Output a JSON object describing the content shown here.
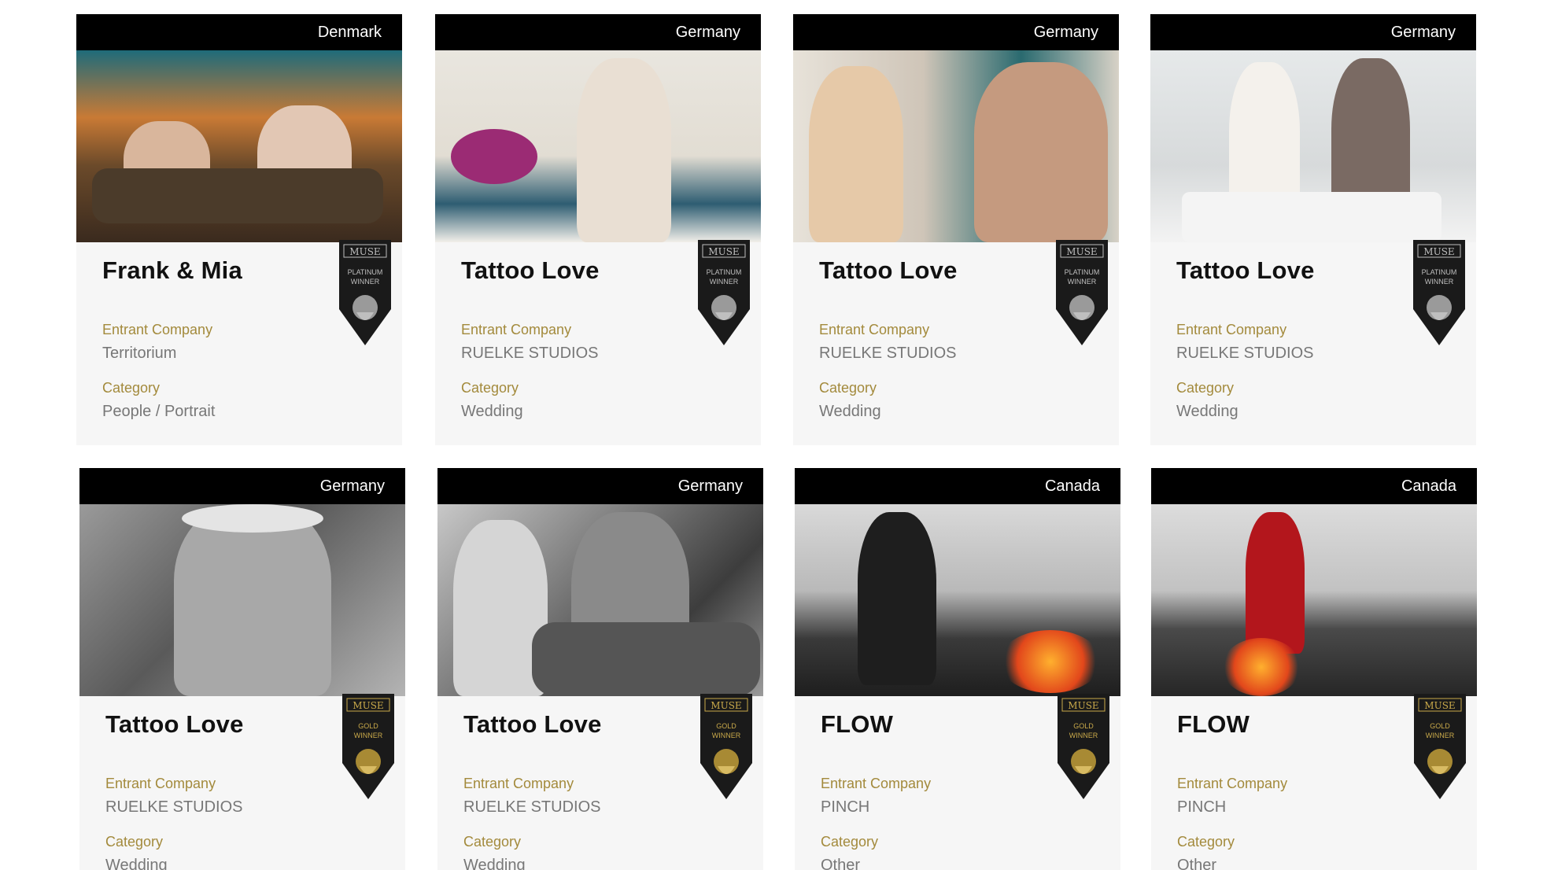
{
  "cards": [
    {
      "country": "Denmark",
      "title": "Frank & Mia",
      "entrant_label": "Entrant Company",
      "entrant": "Territorium",
      "category_label": "Category",
      "category": "People / Portrait",
      "award": "platinum",
      "badge": {
        "brand": "MUSE",
        "line1": "PLATINUM",
        "line2": "WINNER"
      }
    },
    {
      "country": "Germany",
      "title": "Tattoo Love",
      "entrant_label": "Entrant Company",
      "entrant": "RUELKE STUDIOS",
      "category_label": "Category",
      "category": "Wedding",
      "award": "platinum",
      "badge": {
        "brand": "MUSE",
        "line1": "PLATINUM",
        "line2": "WINNER"
      }
    },
    {
      "country": "Germany",
      "title": "Tattoo Love",
      "entrant_label": "Entrant Company",
      "entrant": "RUELKE STUDIOS",
      "category_label": "Category",
      "category": "Wedding",
      "award": "platinum",
      "badge": {
        "brand": "MUSE",
        "line1": "PLATINUM",
        "line2": "WINNER"
      }
    },
    {
      "country": "Germany",
      "title": "Tattoo Love",
      "entrant_label": "Entrant Company",
      "entrant": "RUELKE STUDIOS",
      "category_label": "Category",
      "category": "Wedding",
      "award": "platinum",
      "badge": {
        "brand": "MUSE",
        "line1": "PLATINUM",
        "line2": "WINNER"
      }
    },
    {
      "country": "Germany",
      "title": "Tattoo Love",
      "entrant_label": "Entrant Company",
      "entrant": "RUELKE STUDIOS",
      "category_label": "Category",
      "category": "Wedding",
      "award": "gold",
      "badge": {
        "brand": "MUSE",
        "line1": "GOLD",
        "line2": "WINNER"
      }
    },
    {
      "country": "Germany",
      "title": "Tattoo Love",
      "entrant_label": "Entrant Company",
      "entrant": "RUELKE STUDIOS",
      "category_label": "Category",
      "category": "Wedding",
      "award": "gold",
      "badge": {
        "brand": "MUSE",
        "line1": "GOLD",
        "line2": "WINNER"
      }
    },
    {
      "country": "Canada",
      "title": "FLOW",
      "entrant_label": "Entrant Company",
      "entrant": "PINCH",
      "category_label": "Category",
      "category": "Other ___",
      "award": "gold",
      "badge": {
        "brand": "MUSE",
        "line1": "GOLD",
        "line2": "WINNER"
      }
    },
    {
      "country": "Canada",
      "title": "FLOW",
      "entrant_label": "Entrant Company",
      "entrant": "PINCH",
      "category_label": "Category",
      "category": "Other ___",
      "award": "gold",
      "badge": {
        "brand": "MUSE",
        "line1": "GOLD",
        "line2": "WINNER"
      }
    }
  ],
  "colors": {
    "header_bg": "#000000",
    "label_gold": "#a38a3c",
    "platinum": "#bfbfbf",
    "gold": "#c9a94a"
  }
}
